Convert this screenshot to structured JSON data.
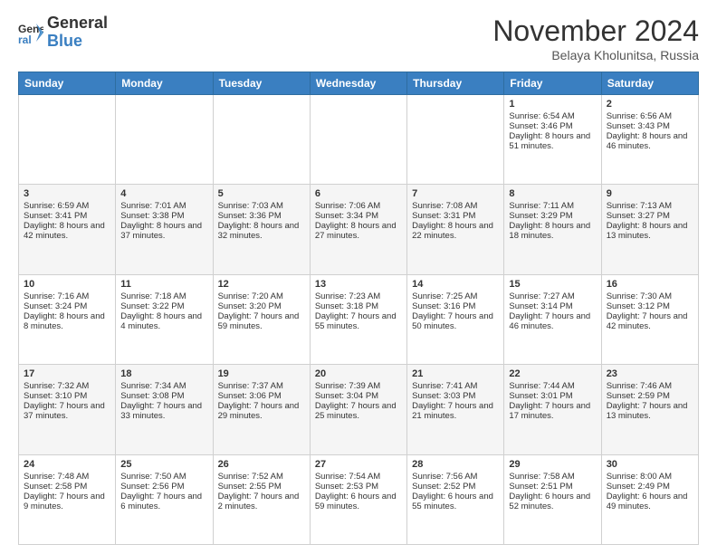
{
  "logo": {
    "line1": "General",
    "line2": "Blue"
  },
  "header": {
    "month": "November 2024",
    "location": "Belaya Kholunitsa, Russia"
  },
  "days_of_week": [
    "Sunday",
    "Monday",
    "Tuesday",
    "Wednesday",
    "Thursday",
    "Friday",
    "Saturday"
  ],
  "weeks": [
    [
      {
        "day": "",
        "info": ""
      },
      {
        "day": "",
        "info": ""
      },
      {
        "day": "",
        "info": ""
      },
      {
        "day": "",
        "info": ""
      },
      {
        "day": "",
        "info": ""
      },
      {
        "day": "1",
        "info": "Sunrise: 6:54 AM\nSunset: 3:46 PM\nDaylight: 8 hours and 51 minutes."
      },
      {
        "day": "2",
        "info": "Sunrise: 6:56 AM\nSunset: 3:43 PM\nDaylight: 8 hours and 46 minutes."
      }
    ],
    [
      {
        "day": "3",
        "info": "Sunrise: 6:59 AM\nSunset: 3:41 PM\nDaylight: 8 hours and 42 minutes."
      },
      {
        "day": "4",
        "info": "Sunrise: 7:01 AM\nSunset: 3:38 PM\nDaylight: 8 hours and 37 minutes."
      },
      {
        "day": "5",
        "info": "Sunrise: 7:03 AM\nSunset: 3:36 PM\nDaylight: 8 hours and 32 minutes."
      },
      {
        "day": "6",
        "info": "Sunrise: 7:06 AM\nSunset: 3:34 PM\nDaylight: 8 hours and 27 minutes."
      },
      {
        "day": "7",
        "info": "Sunrise: 7:08 AM\nSunset: 3:31 PM\nDaylight: 8 hours and 22 minutes."
      },
      {
        "day": "8",
        "info": "Sunrise: 7:11 AM\nSunset: 3:29 PM\nDaylight: 8 hours and 18 minutes."
      },
      {
        "day": "9",
        "info": "Sunrise: 7:13 AM\nSunset: 3:27 PM\nDaylight: 8 hours and 13 minutes."
      }
    ],
    [
      {
        "day": "10",
        "info": "Sunrise: 7:16 AM\nSunset: 3:24 PM\nDaylight: 8 hours and 8 minutes."
      },
      {
        "day": "11",
        "info": "Sunrise: 7:18 AM\nSunset: 3:22 PM\nDaylight: 8 hours and 4 minutes."
      },
      {
        "day": "12",
        "info": "Sunrise: 7:20 AM\nSunset: 3:20 PM\nDaylight: 7 hours and 59 minutes."
      },
      {
        "day": "13",
        "info": "Sunrise: 7:23 AM\nSunset: 3:18 PM\nDaylight: 7 hours and 55 minutes."
      },
      {
        "day": "14",
        "info": "Sunrise: 7:25 AM\nSunset: 3:16 PM\nDaylight: 7 hours and 50 minutes."
      },
      {
        "day": "15",
        "info": "Sunrise: 7:27 AM\nSunset: 3:14 PM\nDaylight: 7 hours and 46 minutes."
      },
      {
        "day": "16",
        "info": "Sunrise: 7:30 AM\nSunset: 3:12 PM\nDaylight: 7 hours and 42 minutes."
      }
    ],
    [
      {
        "day": "17",
        "info": "Sunrise: 7:32 AM\nSunset: 3:10 PM\nDaylight: 7 hours and 37 minutes."
      },
      {
        "day": "18",
        "info": "Sunrise: 7:34 AM\nSunset: 3:08 PM\nDaylight: 7 hours and 33 minutes."
      },
      {
        "day": "19",
        "info": "Sunrise: 7:37 AM\nSunset: 3:06 PM\nDaylight: 7 hours and 29 minutes."
      },
      {
        "day": "20",
        "info": "Sunrise: 7:39 AM\nSunset: 3:04 PM\nDaylight: 7 hours and 25 minutes."
      },
      {
        "day": "21",
        "info": "Sunrise: 7:41 AM\nSunset: 3:03 PM\nDaylight: 7 hours and 21 minutes."
      },
      {
        "day": "22",
        "info": "Sunrise: 7:44 AM\nSunset: 3:01 PM\nDaylight: 7 hours and 17 minutes."
      },
      {
        "day": "23",
        "info": "Sunrise: 7:46 AM\nSunset: 2:59 PM\nDaylight: 7 hours and 13 minutes."
      }
    ],
    [
      {
        "day": "24",
        "info": "Sunrise: 7:48 AM\nSunset: 2:58 PM\nDaylight: 7 hours and 9 minutes."
      },
      {
        "day": "25",
        "info": "Sunrise: 7:50 AM\nSunset: 2:56 PM\nDaylight: 7 hours and 6 minutes."
      },
      {
        "day": "26",
        "info": "Sunrise: 7:52 AM\nSunset: 2:55 PM\nDaylight: 7 hours and 2 minutes."
      },
      {
        "day": "27",
        "info": "Sunrise: 7:54 AM\nSunset: 2:53 PM\nDaylight: 6 hours and 59 minutes."
      },
      {
        "day": "28",
        "info": "Sunrise: 7:56 AM\nSunset: 2:52 PM\nDaylight: 6 hours and 55 minutes."
      },
      {
        "day": "29",
        "info": "Sunrise: 7:58 AM\nSunset: 2:51 PM\nDaylight: 6 hours and 52 minutes."
      },
      {
        "day": "30",
        "info": "Sunrise: 8:00 AM\nSunset: 2:49 PM\nDaylight: 6 hours and 49 minutes."
      }
    ]
  ]
}
